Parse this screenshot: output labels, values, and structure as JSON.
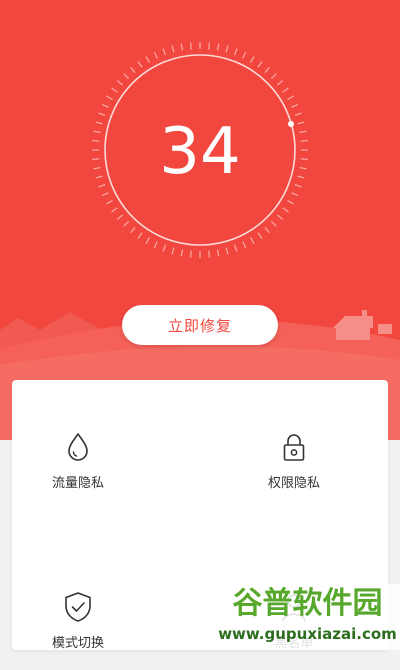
{
  "score": {
    "value": "34"
  },
  "primary_action": {
    "label": "立即修复"
  },
  "features": [
    {
      "label": "流量隐私",
      "icon": "water-drop-icon"
    },
    {
      "label": "权限隐私",
      "icon": "padlock-icon"
    },
    {
      "label": "模式切换",
      "icon": "shield-check-icon"
    },
    {
      "label": "黑名单",
      "icon": "person-icon"
    }
  ],
  "watermark": {
    "brand": "谷普软件园",
    "url": "www.gupuxiazai.com"
  },
  "colors": {
    "primary": "#f2473f",
    "background": "#f1f1f1",
    "card": "#ffffff"
  }
}
